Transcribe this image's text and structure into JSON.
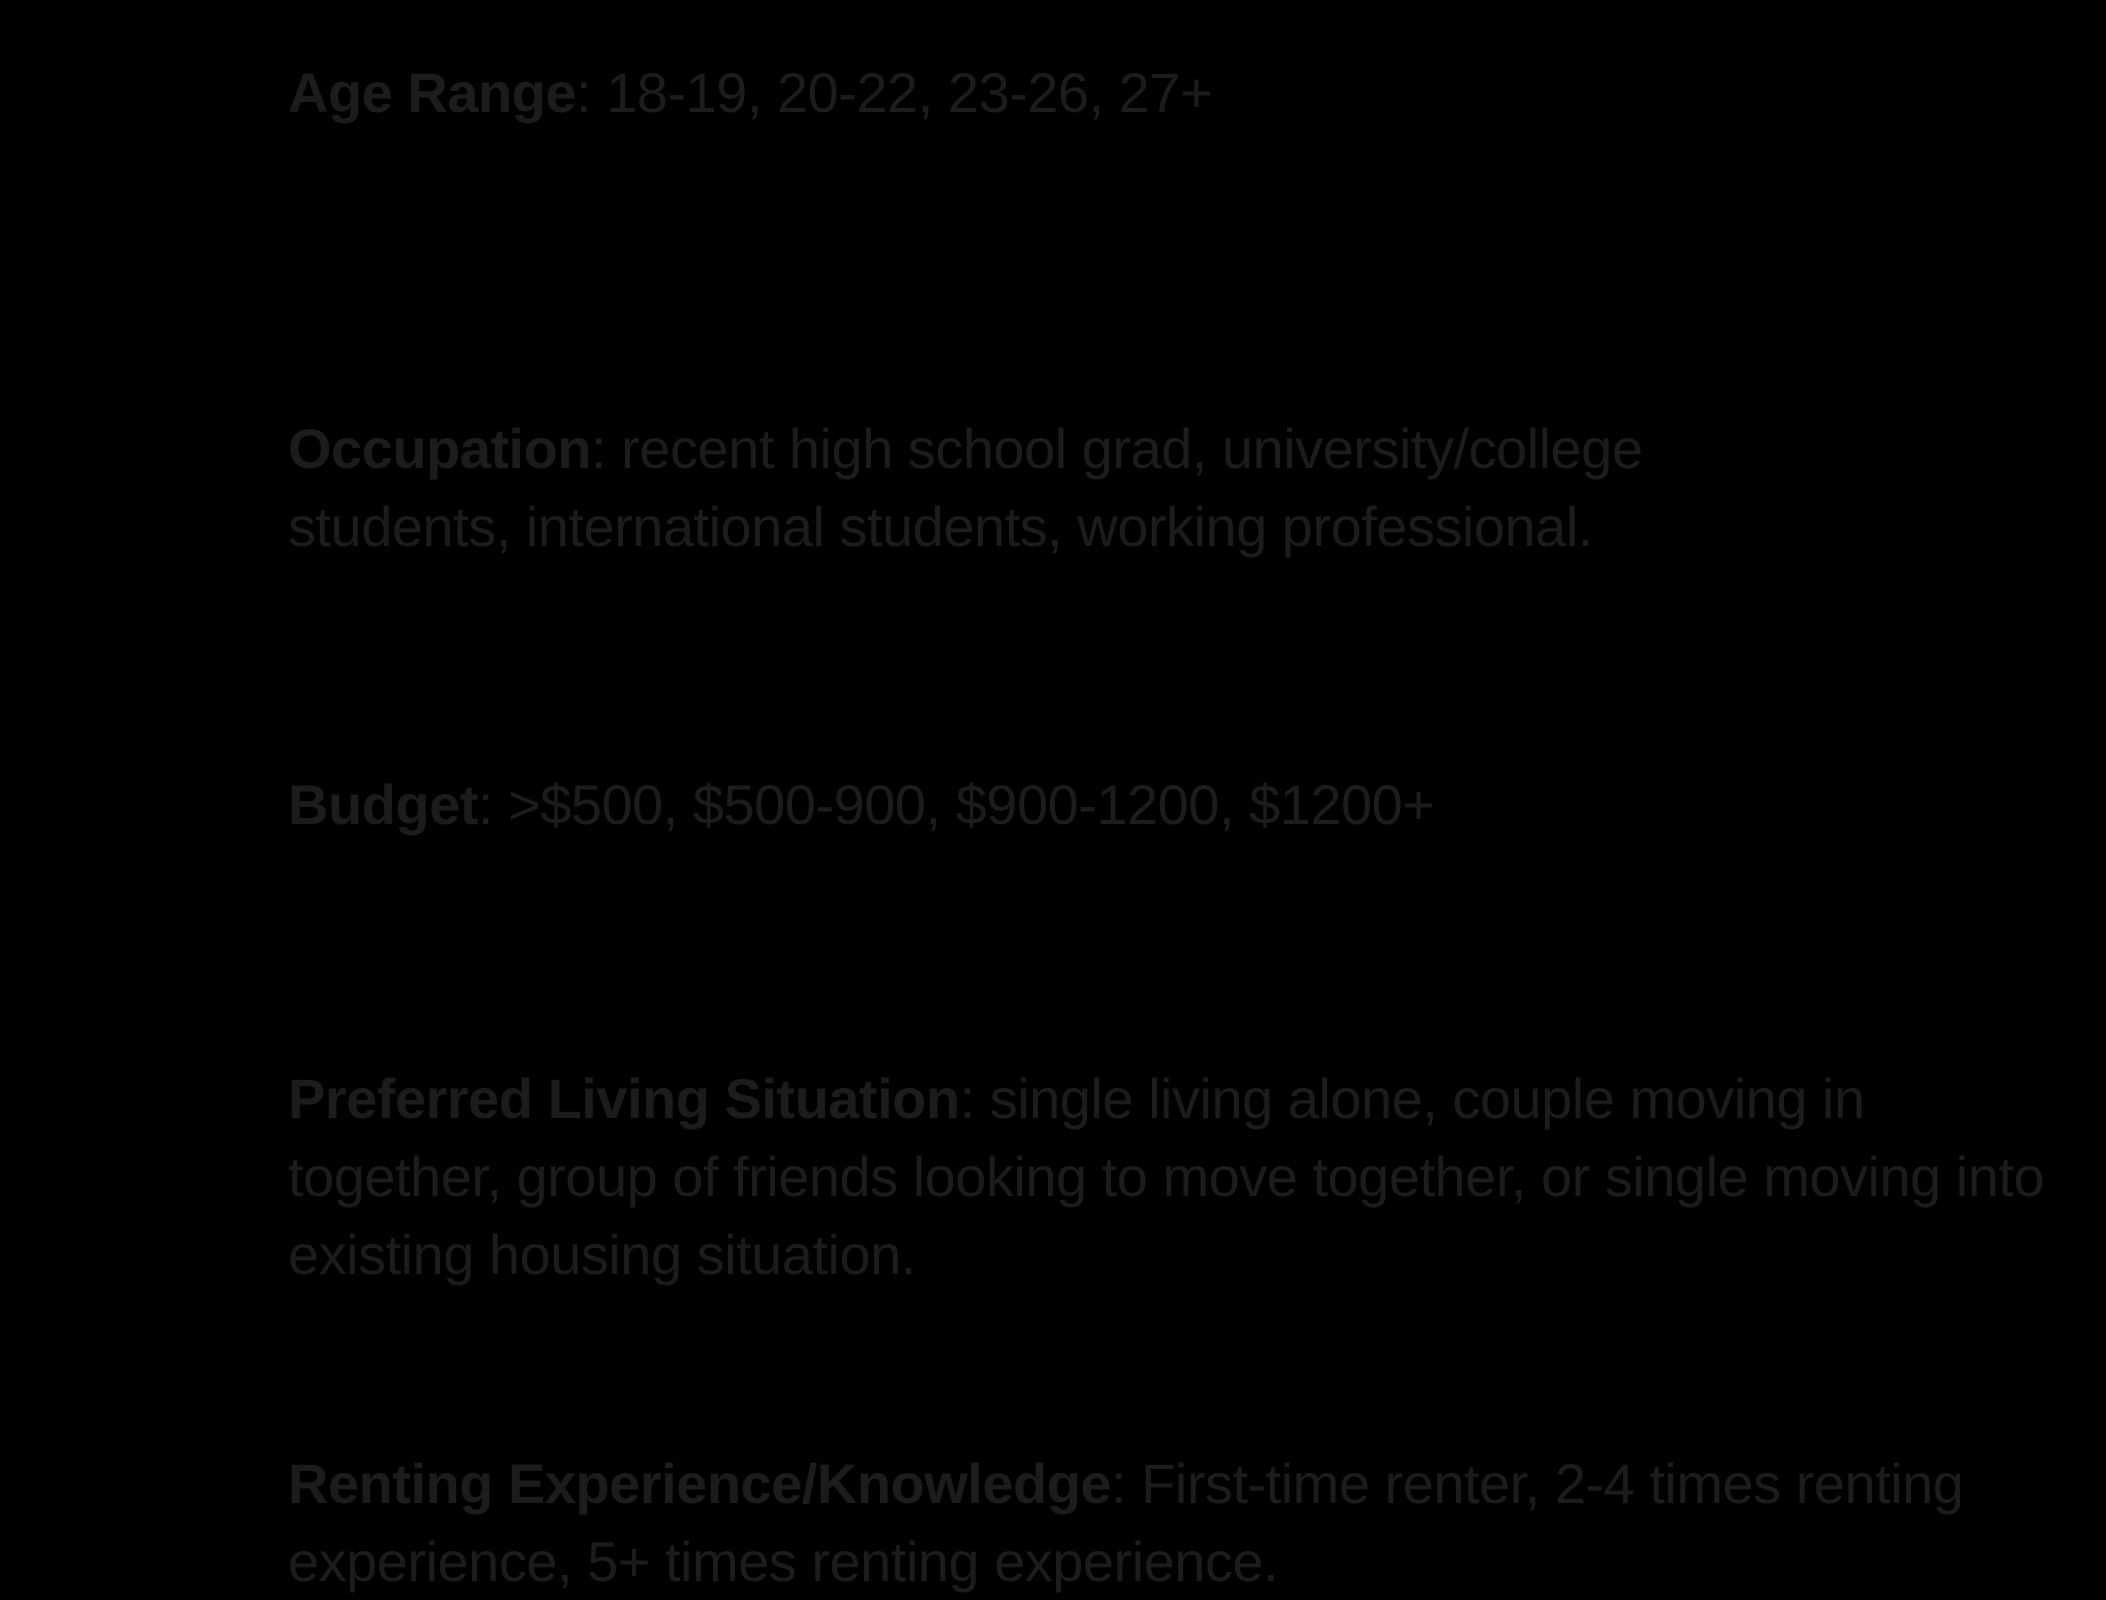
{
  "entries": [
    {
      "label": "Age Range",
      "separator": ": ",
      "text": "18-19, 20-22, 23-26, 27+"
    },
    {
      "label": "Occupation",
      "separator": ": ",
      "text": "recent high school grad, university/college students, international students, working professional."
    },
    {
      "label": "Budget",
      "separator": ": ",
      "text": ">$500, $500-900, $900-1200, $1200+"
    },
    {
      "label": "Preferred Living Situation",
      "separator": ": ",
      "text": "single living alone, couple moving in together, group  of friends looking to move together, or single moving into existing housing situation."
    },
    {
      "label": "Renting Experience/Knowledge",
      "separator": ": ",
      "text": "First-time renter, 2-4 times renting experience, 5+ times renting experience."
    }
  ],
  "colors": {
    "background": "#000000",
    "text": "#1c1c1c"
  }
}
